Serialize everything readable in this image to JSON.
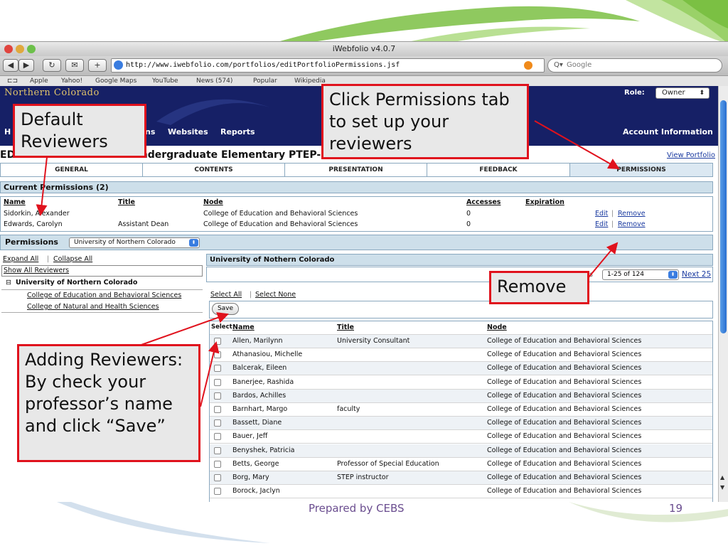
{
  "window": {
    "title": "iWebfolio v4.0.7",
    "url": "http://www.iwebfolio.com/portfolios/editPortfolioPermissions.jsf",
    "search_placeholder": "Google",
    "bookmarks": [
      "Apple",
      "Yahoo!",
      "Google Maps",
      "YouTube",
      "News (574)",
      "Popular",
      "Wikipedia"
    ]
  },
  "header": {
    "brand": "Northern Colorado",
    "nav": [
      "H",
      "ns",
      "Websites",
      "Reports"
    ],
    "account": "Account Information",
    "role_label": "Role:",
    "role_value": "Owner"
  },
  "page": {
    "title": "EDIT PORTFOLIO: CSE - Undergraduate Elementary PTEP-2007/2008",
    "view_portfolio": "View Portfolio",
    "tabs": [
      "GENERAL",
      "CONTENTS",
      "PRESENTATION",
      "FEEDBACK",
      "PERMISSIONS"
    ],
    "active_tab": "PERMISSIONS"
  },
  "current_permissions": {
    "heading": "Current Permissions (2)",
    "columns": [
      "Name",
      "Title",
      "Node",
      "Accesses",
      "Expiration"
    ],
    "rows": [
      {
        "name": "Sidorkin, Alexander",
        "title": "",
        "node": "College of Education and Behavioral Sciences",
        "accesses": "0",
        "edit": "Edit",
        "remove": "Remove"
      },
      {
        "name": "Edwards, Carolyn",
        "title": "Assistant Dean",
        "node": "College of Education and Behavioral Sciences",
        "accesses": "0",
        "edit": "Edit",
        "remove": "Remove"
      }
    ]
  },
  "permissions": {
    "label": "Permissions",
    "selected": "University of Northern Colorado",
    "expand_all": "Expand All",
    "collapse_all": "Collapse All",
    "show_all": "Show All Reviewers",
    "tree_root": "University of Northern Colorado",
    "tree_children": [
      "College of Education and Behavioral Sciences",
      "College of Natural and Health Sciences"
    ]
  },
  "reviewers": {
    "heading": "University of Nothern Colorado",
    "page_label": "1-25 of 124",
    "next": "Next 25",
    "select_all": "Select All",
    "select_none": "Select None",
    "save": "Save",
    "columns": [
      "Select",
      "Name",
      "Title",
      "Node"
    ],
    "rows": [
      {
        "name": "Allen, Marilynn",
        "title": "University Consultant",
        "node": "College of Education and Behavioral Sciences"
      },
      {
        "name": "Athanasiou, Michelle",
        "title": "",
        "node": "College of Education and Behavioral Sciences"
      },
      {
        "name": "Balcerak, Eileen",
        "title": "",
        "node": "College of Education and Behavioral Sciences"
      },
      {
        "name": "Banerjee, Rashida",
        "title": "",
        "node": "College of Education and Behavioral Sciences"
      },
      {
        "name": "Bardos, Achilles",
        "title": "",
        "node": "College of Education and Behavioral Sciences"
      },
      {
        "name": "Barnhart, Margo",
        "title": "faculty",
        "node": "College of Education and Behavioral Sciences"
      },
      {
        "name": "Bassett, Diane",
        "title": "",
        "node": "College of Education and Behavioral Sciences"
      },
      {
        "name": "Bauer, Jeff",
        "title": "",
        "node": "College of Education and Behavioral Sciences"
      },
      {
        "name": "Benyshek, Patricia",
        "title": "",
        "node": "College of Education and Behavioral Sciences"
      },
      {
        "name": "Betts, George",
        "title": "Professor of Special Education",
        "node": "College of Education and Behavioral Sciences"
      },
      {
        "name": "Borg, Mary",
        "title": "STEP instructor",
        "node": "College of Education and Behavioral Sciences"
      },
      {
        "name": "Borock, Jaclyn",
        "title": "",
        "node": "College of Education and Behavioral Sciences"
      }
    ]
  },
  "callouts": {
    "default_reviewers": "Default Reviewers",
    "permissions_tab": "Click Permissions tab to set up your reviewers",
    "remove": "Remove",
    "adding": "Adding Reviewers: By check your professor’s name and click “Save”"
  },
  "footer": {
    "text": "Prepared by CEBS",
    "slide_number": "19"
  },
  "colors": {
    "header_bg": "#162066",
    "accent_gold": "#e0c36a",
    "callout_border": "#e0121d",
    "deco_green": "#7bc043",
    "footer_text": "#6a4d8f"
  }
}
